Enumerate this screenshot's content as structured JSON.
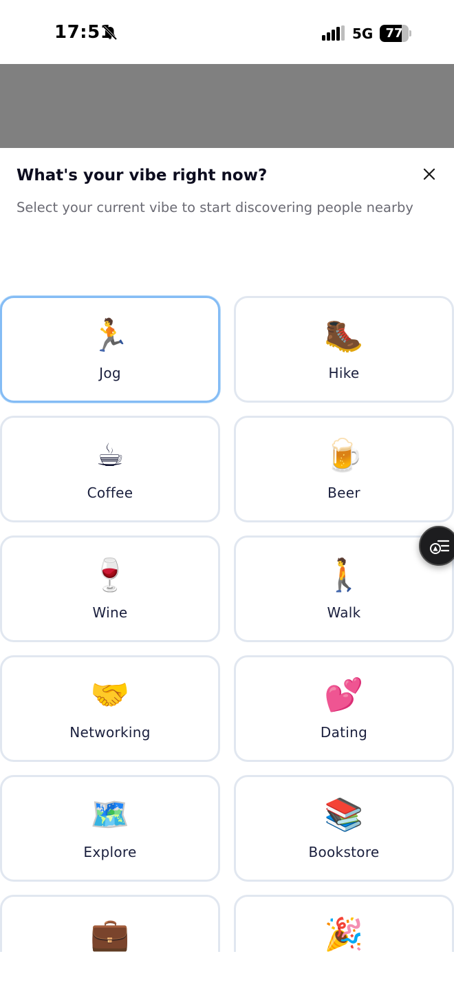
{
  "status_bar": {
    "time": "17:51",
    "network": "5G",
    "battery_level": "77",
    "battery_fraction": 0.77,
    "icons": {
      "silent": "bell-slash-icon",
      "signal": "signal-icon"
    }
  },
  "sheet": {
    "title": "What's your vibe right now?",
    "subtitle": "Select your current vibe to start discovering people nearby",
    "close_icon": "close-icon"
  },
  "vibes": [
    {
      "label": "Jog",
      "emoji": "🏃",
      "selected": true
    },
    {
      "label": "Hike",
      "emoji": "🥾",
      "selected": false
    },
    {
      "label": "Coffee",
      "emoji": "☕",
      "selected": false
    },
    {
      "label": "Beer",
      "emoji": "🍺",
      "selected": false
    },
    {
      "label": "Wine",
      "emoji": "🍷",
      "selected": false
    },
    {
      "label": "Walk",
      "emoji": "🚶",
      "selected": false
    },
    {
      "label": "Networking",
      "emoji": "🤝",
      "selected": false
    },
    {
      "label": "Dating",
      "emoji": "💕",
      "selected": false
    },
    {
      "label": "Explore",
      "emoji": "🗺️",
      "selected": false
    },
    {
      "label": "Bookstore",
      "emoji": "📚",
      "selected": false
    },
    {
      "label": "",
      "emoji": "💼",
      "selected": false
    },
    {
      "label": "",
      "emoji": "🎉",
      "selected": false
    }
  ],
  "floating_button": {
    "icon": "list-filter-icon"
  },
  "colors": {
    "selected_border": "#84bcf5",
    "card_border": "#e1e7f0",
    "backdrop": "#808080"
  }
}
